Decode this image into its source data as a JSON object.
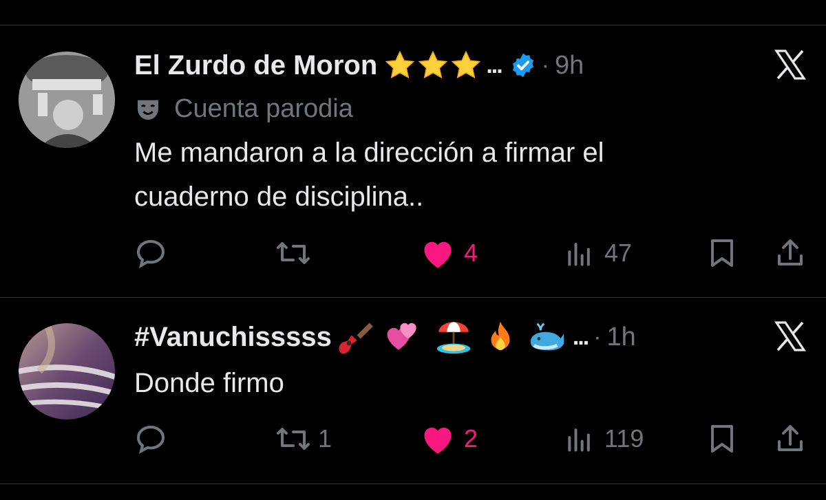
{
  "colors": {
    "background": "#000000",
    "text": "#e7e9ea",
    "muted": "#71767b",
    "like": "#f91880",
    "verified": "#1d9bf0"
  },
  "tweets": [
    {
      "author": "El Zurdo de Moron",
      "name_emojis": [
        "star-emoji",
        "star-emoji",
        "star-emoji"
      ],
      "ellipsis": "...",
      "verified": true,
      "dot": "·",
      "time": "9h",
      "label": "Cuenta parodia",
      "text_lines": [
        "Me mandaron a la dirección a firmar el",
        "cuaderno de disciplina.."
      ],
      "replies": "",
      "retweets": "",
      "likes": "4",
      "views": "47",
      "liked": true
    },
    {
      "author": "#Vanuchisssss",
      "name_emojis": [
        "guitar-emoji",
        "heart-emoji",
        "beach-emoji",
        "fire-emoji",
        "whale-emoji"
      ],
      "ellipsis": "...",
      "verified": false,
      "dot": "·",
      "time": "1h",
      "text_lines": [
        "Donde firmo"
      ],
      "replies": "",
      "retweets": "1",
      "likes": "2",
      "views": "119",
      "liked": true
    }
  ]
}
